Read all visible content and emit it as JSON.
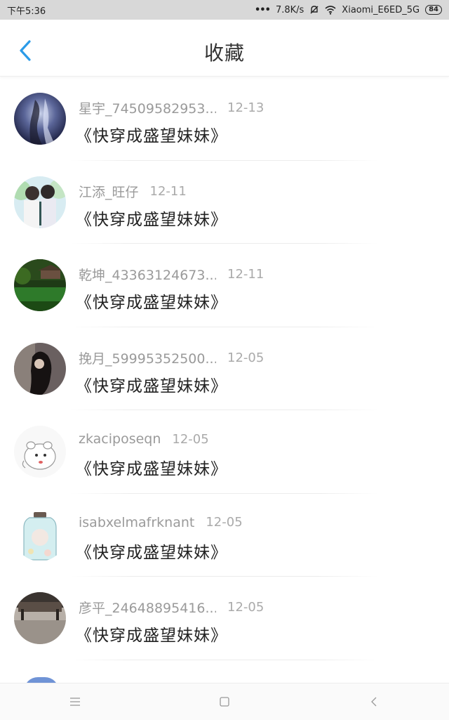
{
  "status_bar": {
    "time": "下午5:36",
    "speed": "7.8K/s",
    "network": "Xiaomi_E6ED_5G",
    "battery": "84"
  },
  "header": {
    "title": "收藏",
    "back_icon": "chevron-left-icon"
  },
  "colors": {
    "accent": "#2b9be8",
    "status_bar_bg": "#d8d8d8"
  },
  "items": [
    {
      "username": "星宇_74509582953...",
      "date": "12-13",
      "book": "《快穿成盛望妹妹》"
    },
    {
      "username": "江添_旺仔",
      "date": "12-11",
      "book": "《快穿成盛望妹妹》"
    },
    {
      "username": "乾坤_43363124673...",
      "date": "12-11",
      "book": "《快穿成盛望妹妹》"
    },
    {
      "username": "挽月_59995352500...",
      "date": "12-05",
      "book": "《快穿成盛望妹妹》"
    },
    {
      "username": "zkaciposeqn",
      "date": "12-05",
      "book": "《快穿成盛望妹妹》"
    },
    {
      "username": "isabxelmafrknant",
      "date": "12-05",
      "book": "《快穿成盛望妹妹》"
    },
    {
      "username": "彦平_24648895416...",
      "date": "12-05",
      "book": "《快穿成盛望妹妹》"
    }
  ],
  "nav_bar": {
    "menu_icon": "menu-icon",
    "home_icon": "home-square-icon",
    "back_icon": "back-chevron-icon"
  }
}
